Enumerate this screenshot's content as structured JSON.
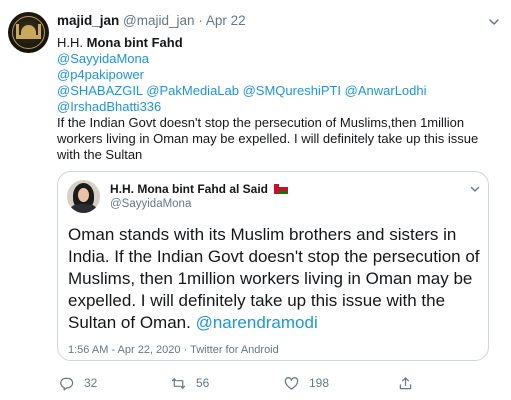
{
  "tweet": {
    "author_name": "majid_jan",
    "author_handle": "@majid_jan",
    "separator": "·",
    "date": "Apr 22",
    "text_prefix": "H.H. ",
    "text_bold_name": "Mona bint Fahd",
    "mentions_line1": "@SayyidaMona",
    "mentions_line2": "@p4pakipower",
    "mentions_line3": "@SHABAZGIL @PakMediaLab @SMQureshiPTI @AnwarLodhi",
    "mentions_line4": "@IrshadBhatti336",
    "body_text": "If the Indian Govt doesn't stop the persecution of Muslims,then 1million workers living in Oman may be expelled. I will definitely take up this issue with the Sultan"
  },
  "quoted_tweet": {
    "author_name": "H.H. Mona bint Fahd al Said",
    "author_handle": "@SayyidaMona",
    "text": "Oman stands with its Muslim brothers and sisters in India. If the Indian Govt doesn't stop the persecution of Muslims, then 1million workers living in Oman may be expelled. I will definitely take up this issue with the Sultan of Oman. ",
    "mention": "@narendramodi",
    "meta": "1:56 AM - Apr 22, 2020 · Twitter for Android"
  },
  "actions": {
    "reply_count": "32",
    "retweet_count": "56",
    "like_count": "198"
  },
  "colors": {
    "link": "#1b95e0",
    "secondary_text": "#657786",
    "border": "#ccd6dd"
  },
  "icons": [
    "chevron-down-icon",
    "reply-icon",
    "retweet-icon",
    "like-icon",
    "share-icon",
    "oman-flag-icon"
  ]
}
